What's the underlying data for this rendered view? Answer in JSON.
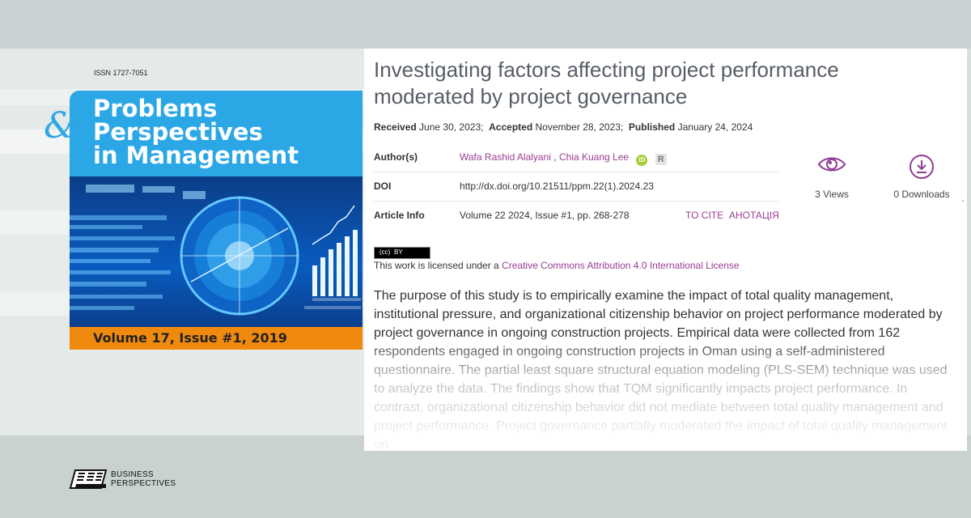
{
  "journal": {
    "issn": "ISSN 1727-7051",
    "ampersand": "&",
    "title_lines": [
      "Problems",
      "Perspectives",
      "in Management"
    ],
    "issue": "Volume 17, Issue #1, 2019",
    "brand_color": "#2ba7e6",
    "accent_color": "#f08a0f"
  },
  "publisher": {
    "name_lines": [
      "BUSINESS",
      "PERSPECTIVES"
    ]
  },
  "article": {
    "title": "Investigating factors affecting project performance moderated by project governance",
    "dates": {
      "received_label": "Received",
      "received": "June 30, 2023;",
      "accepted_label": "Accepted",
      "accepted": "November 28, 2023;",
      "published_label": "Published",
      "published": "January 24, 2024"
    },
    "authors_label": "Author(s)",
    "authors": [
      "Wafa Rashid Alalyani",
      "Chia Kuang Lee"
    ],
    "author_separator": " , ",
    "orcid_icon_text": "iD",
    "researcher_icon_text": "R",
    "doi_label": "DOI",
    "doi": "http://dx.doi.org/10.21511/ppm.22(1).2024.23",
    "info_label": "Article Info",
    "info": "Volume 22 2024, Issue #1, pp. 268-278",
    "to_cite": "TO CITE",
    "annotation": "АНОТАЦІЯ",
    "link_color": "#9a3c94"
  },
  "stats": {
    "views": "3 Views",
    "downloads": "0 Downloads",
    "trailing_mark": "."
  },
  "license": {
    "badge_cc": "(cc)",
    "badge_by": "BY",
    "prefix": "This work is licensed under a ",
    "link": "Creative Commons Attribution 4.0 International License"
  },
  "abstract": "The purpose of this study is to empirically examine the impact of total quality management, institutional pressure, and organizational citizenship behavior on project performance moderated by project governance in ongoing construction projects. Empirical data were collected from 162 respondents engaged in ongoing construction projects in Oman using a self-administered questionnaire. The partial least square structural equation modeling (PLS-SEM) technique was used to analyze the data. The findings show that TQM significantly impacts project performance. In contrast, organizational citizenship behavior did not mediate between total quality management and project performance. Project governance partially moderated the impact of total quality management on"
}
